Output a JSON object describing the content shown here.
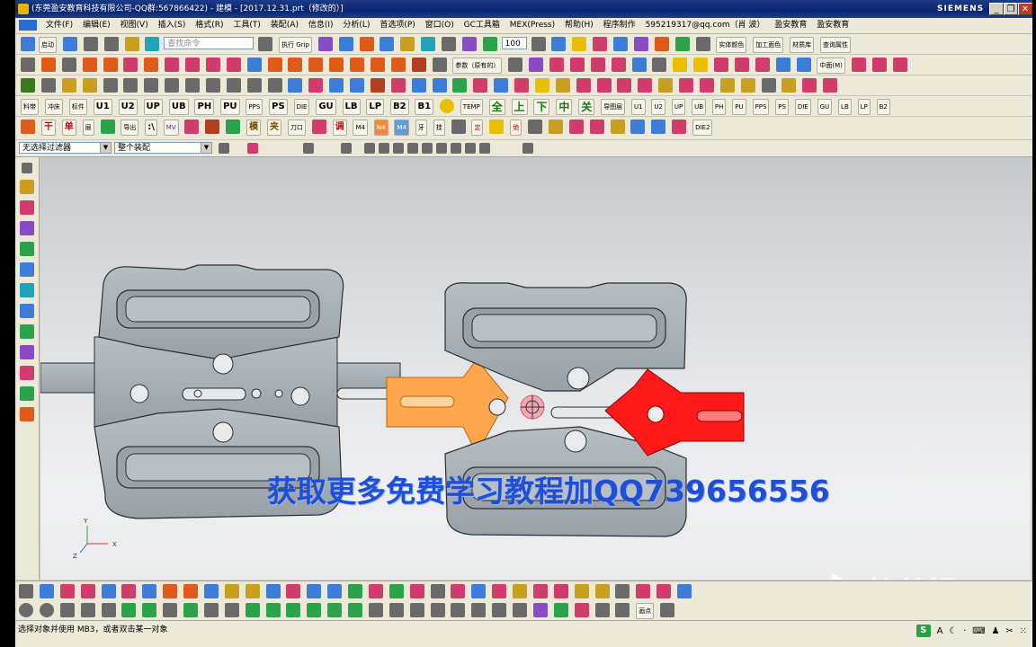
{
  "window": {
    "title": "(东莞盈安教育科技有限公司-QQ群:567866422) - 建模 - [2017.12.31.prt（修改的）]",
    "brand": "SIEMENS",
    "controls": {
      "minimize": "_",
      "restore": "❐",
      "close": "✕"
    }
  },
  "menu": {
    "items": [
      "文件(F)",
      "编辑(E)",
      "视图(V)",
      "插入(S)",
      "格式(R)",
      "工具(T)",
      "装配(A)",
      "信息(I)",
      "分析(L)",
      "首选项(P)",
      "窗口(O)",
      "GC工具箱",
      "MEX(Press)",
      "帮助(H)",
      "程序制作",
      "595219317@qq.com（肖 波）",
      "盈安教育",
      "盈安教育"
    ]
  },
  "toolbar1": {
    "start_label": "启动",
    "search_placeholder": "查找命令",
    "grip_label": "执行 Grip",
    "zoom_value": "100",
    "right_labels": [
      "实体颜色",
      "加工面色",
      "材质库",
      "查询属性"
    ]
  },
  "toolbar2": {
    "param_label": "参数（原有的）",
    "center_label": "中面(M)"
  },
  "toolbar4": {
    "labels": [
      "料带",
      "冲床",
      "标件",
      "U1",
      "U2",
      "UP",
      "UB",
      "PH",
      "PU",
      "PPS",
      "PS",
      "DIE",
      "GU",
      "LB",
      "LP",
      "B2",
      "B1",
      "TEMP",
      "全",
      "上",
      "下",
      "中",
      "关",
      "导图层",
      "U1",
      "U2",
      "UP",
      "UB",
      "PH",
      "PU",
      "PPS",
      "PS",
      "DIE",
      "GU",
      "LB",
      "LP",
      "B2"
    ]
  },
  "toolbar5": {
    "labels": [
      "干",
      "单",
      "层",
      "导出",
      ":\\",
      "MV",
      "模",
      "夹",
      "刀口",
      "调",
      "M4",
      "N4",
      "M4",
      "牙",
      "挂",
      "定",
      "绝",
      "DIE2"
    ]
  },
  "filter": {
    "type_filter": "无选择过滤器",
    "scope": "整个装配"
  },
  "viewport": {
    "watermark": "获取更多免费学习教程加QQ739656556",
    "triad": {
      "x": "X",
      "y": "Y",
      "z": "Z"
    },
    "colors": {
      "part": "#a9b1b6",
      "orange": "#ffa64d",
      "red": "#ff1a1a",
      "edge": "#2a2f33"
    }
  },
  "overlay": {
    "app_logo_text": "快剪辑"
  },
  "bottom": {
    "point_label": "画点"
  },
  "status": {
    "message": "选择对象并使用 MB3，或者双击某一对象"
  },
  "tray": {
    "s_icon": "S",
    "ime_label": "A"
  }
}
